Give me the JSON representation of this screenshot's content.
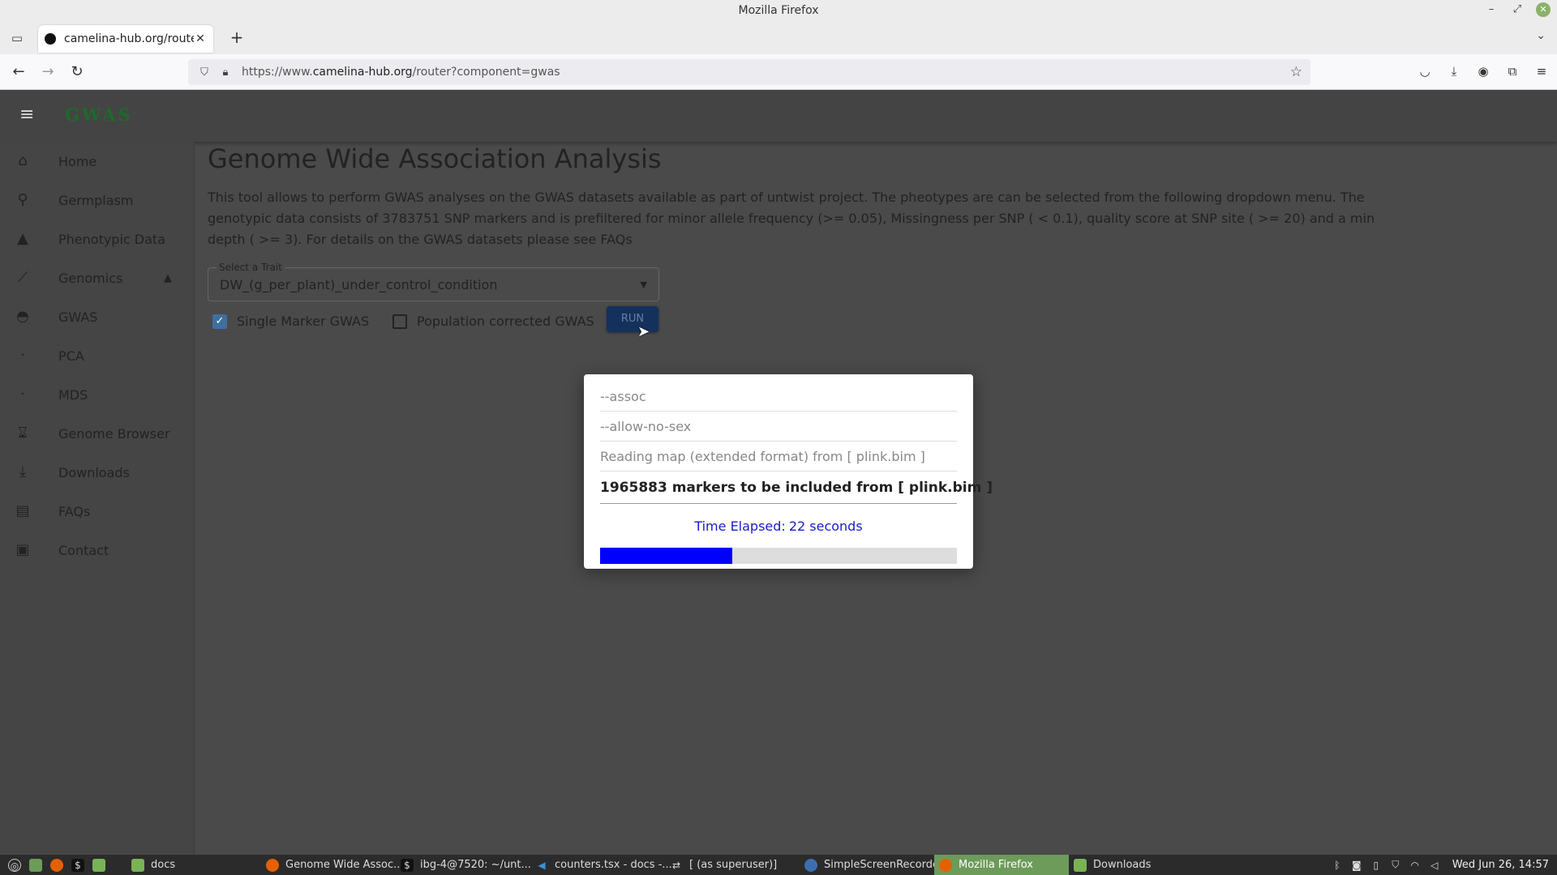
{
  "browser": {
    "window_title": "Mozilla Firefox",
    "tab_title": "camelina-hub.org/router?co",
    "url_prefix": "https://www.",
    "url_domain": "camelina-hub.org",
    "url_path": "/router?component=gwas"
  },
  "app": {
    "brand": "GWAS"
  },
  "sidebar": {
    "items": [
      {
        "label": "Home",
        "icon": "home-icon"
      },
      {
        "label": "Germplasm",
        "icon": "location-pin-icon"
      },
      {
        "label": "Phenotypic Data",
        "icon": "tree-icon"
      },
      {
        "label": "Genomics",
        "icon": "chart-line-icon"
      },
      {
        "label": "GWAS",
        "icon": "gwas-icon"
      },
      {
        "label": "PCA",
        "icon": "pca-icon"
      },
      {
        "label": "MDS",
        "icon": "mds-icon"
      },
      {
        "label": "Genome Browser",
        "icon": "hourglass-icon"
      },
      {
        "label": "Downloads",
        "icon": "download-icon"
      },
      {
        "label": "FAQs",
        "icon": "library-icon"
      },
      {
        "label": "Contact",
        "icon": "contact-card-icon"
      }
    ]
  },
  "main": {
    "title": "Genome Wide Association Analysis",
    "description": "This tool allows to perform GWAS analyses on the GWAS datasets available as part of untwist project. The pheotypes are can be selected from the following dropdown menu. The genotypic data consists of 3783751 SNP markers and is prefiltered for minor allele frequency (>= 0.05), Missingness per SNP ( < 0.1), quality score at SNP site ( >= 20) and a min depth ( >= 3). For details on the GWAS datasets please see FAQs",
    "select_label": "Select a Trait",
    "select_value": "DW_(g_per_plant)_under_control_condition",
    "single_marker_label": "Single Marker GWAS",
    "single_marker_checked": true,
    "population_label": "Population corrected GWAS",
    "population_checked": false,
    "run_label": "RUN"
  },
  "modal": {
    "lines": [
      "--assoc",
      "--allow-no-sex",
      "Reading map (extended format) from [ plink.bim ]",
      "1965883 markers to be included from [ plink.bim ]"
    ],
    "elapsed_prefix": "Time Elapsed:",
    "elapsed_value": "22 seconds",
    "progress_percent": 37
  },
  "taskbar": {
    "apps": [
      {
        "label": "docs",
        "icon": "folder-icon"
      },
      {
        "label": "Genome Wide Assoc...",
        "icon": "firefox-icon"
      },
      {
        "label": "ibg-4@7520: ~/unt...",
        "icon": "terminal-icon"
      },
      {
        "label": "counters.tsx - docs -...",
        "icon": "vscode-icon"
      },
      {
        "label": "[ (as superuser)]",
        "icon": "app-icon"
      },
      {
        "label": "SimpleScreenRecorder",
        "icon": "recorder-icon"
      },
      {
        "label": "Mozilla Firefox",
        "icon": "firefox-icon"
      },
      {
        "label": "Downloads",
        "icon": "folder-icon"
      }
    ],
    "clock": "Wed Jun 26, 14:57"
  }
}
